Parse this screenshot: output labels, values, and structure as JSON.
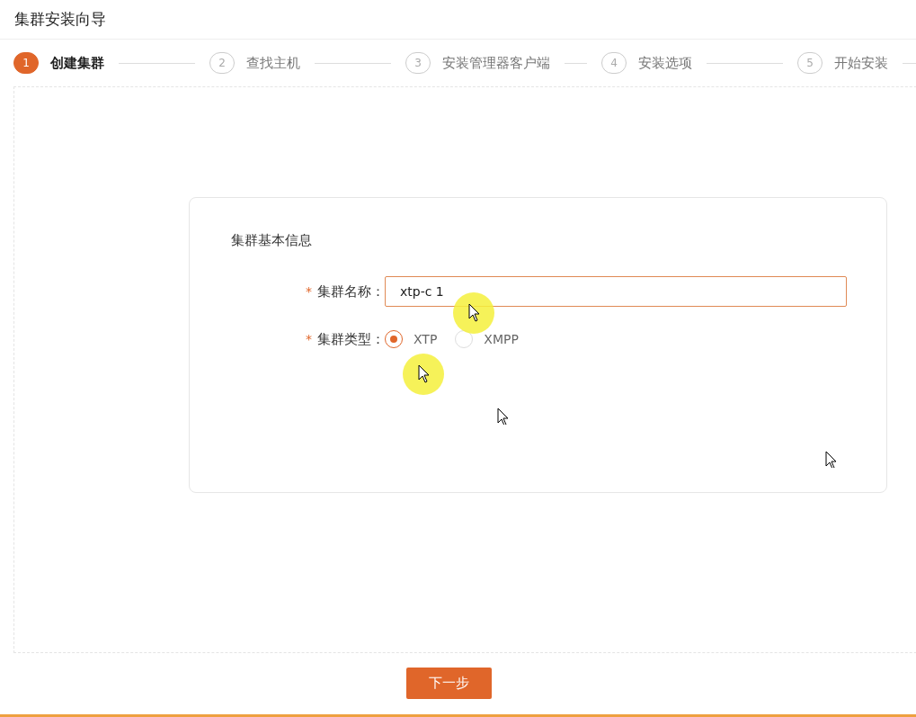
{
  "window": {
    "title": "集群安装向导"
  },
  "steps": [
    {
      "number": "1",
      "label": "创建集群",
      "selected": true
    },
    {
      "number": "2",
      "label": "查找主机",
      "selected": false
    },
    {
      "number": "3",
      "label": "安装管理器客户端",
      "selected": false
    },
    {
      "number": "4",
      "label": "安装选项",
      "selected": false
    },
    {
      "number": "5",
      "label": "开始安装",
      "selected": false
    }
  ],
  "form": {
    "title": "集群基本信息",
    "fields": [
      {
        "kind": "text",
        "required_mark": "*",
        "label": "集群名称：",
        "value": "xtp-c 1"
      },
      {
        "kind": "radio",
        "required_mark": "*",
        "label": "集群类型：",
        "options": [
          {
            "label": "XTP",
            "selected": true
          },
          {
            "label": "XMPP",
            "selected": false
          }
        ]
      }
    ]
  },
  "buttons": [
    {
      "label": "下一步"
    }
  ]
}
